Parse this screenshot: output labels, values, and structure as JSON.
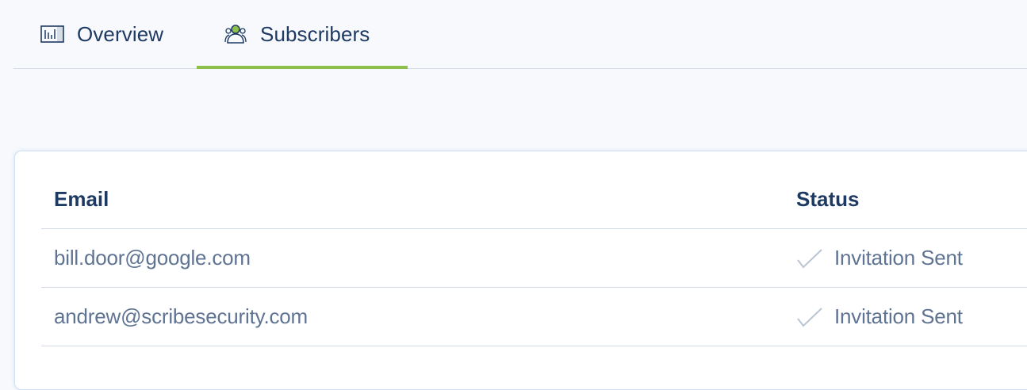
{
  "tabs": [
    {
      "label": "Overview",
      "icon": "bar-chart-icon",
      "active": false
    },
    {
      "label": "Subscribers",
      "icon": "users-icon",
      "active": true
    }
  ],
  "colors": {
    "accent": "#8cc04b",
    "heading": "#1e3a63",
    "body_text": "#5f7393",
    "check": "#b9c4d4"
  },
  "table": {
    "columns": [
      "Email",
      "Status"
    ],
    "rows": [
      {
        "email": "bill.door@google.com",
        "status": "Invitation Sent",
        "status_icon": "check-icon"
      },
      {
        "email": "andrew@scribesecurity.com",
        "status": "Invitation Sent",
        "status_icon": "check-icon"
      }
    ]
  }
}
